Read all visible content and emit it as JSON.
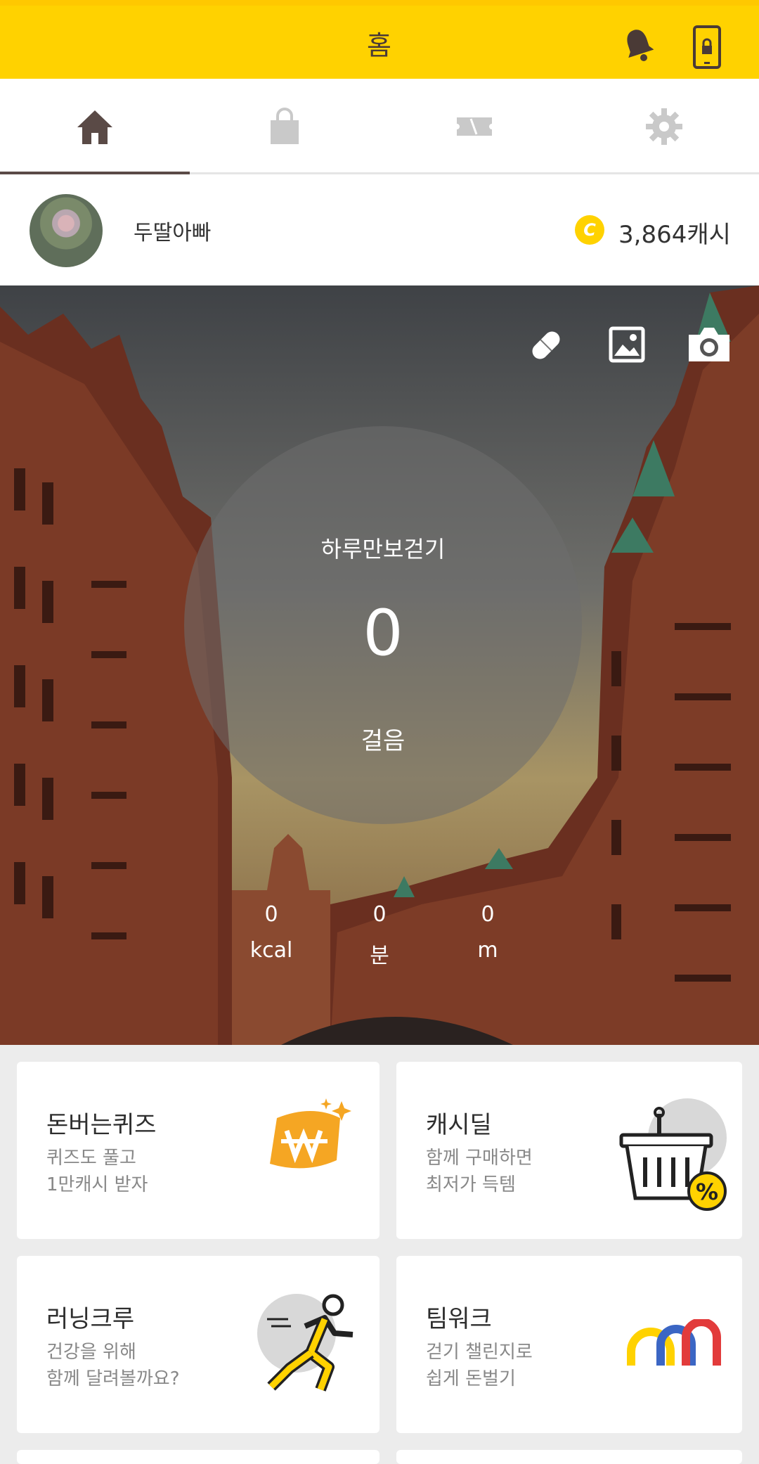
{
  "header": {
    "title": "홈",
    "icons": [
      "bell-icon",
      "phone-lock-icon"
    ]
  },
  "tabs": [
    {
      "icon": "home-icon",
      "active": true
    },
    {
      "icon": "shopping-bag-icon",
      "active": false
    },
    {
      "icon": "ticket-icon",
      "active": false
    },
    {
      "icon": "gear-icon",
      "active": false
    }
  ],
  "profile": {
    "username": "두딸아빠",
    "coin_symbol": "C",
    "coins": "3,864캐시"
  },
  "hero": {
    "tool_icons": [
      "pill-icon",
      "image-icon",
      "camera-icon"
    ],
    "title": "하루만보걷기",
    "steps": "0",
    "steps_label": "걸음",
    "stats": [
      {
        "value": "0",
        "unit": "kcal"
      },
      {
        "value": "0",
        "unit": "분"
      },
      {
        "value": "0",
        "unit": "m"
      }
    ]
  },
  "cards": [
    {
      "title": "돈버는퀴즈",
      "sub1": "퀴즈도 풀고",
      "sub2": "1만캐시 받자",
      "icon": "won-coin-icon"
    },
    {
      "title": "캐시딜",
      "sub1": "함께 구매하면",
      "sub2": "최저가 득템",
      "icon": "basket-discount-icon"
    },
    {
      "title": "러닝크루",
      "sub1": "건강을 위해",
      "sub2": "함께 달려볼까요?",
      "icon": "runner-icon"
    },
    {
      "title": "팀워크",
      "sub1": "걷기 챌린지로",
      "sub2": "쉽게 돈벌기",
      "icon": "teamwork-arches-icon"
    }
  ],
  "colors": {
    "brand_yellow": "#ffd200",
    "tab_active": "#5a4a46",
    "tab_inactive": "#c9c9c9"
  }
}
